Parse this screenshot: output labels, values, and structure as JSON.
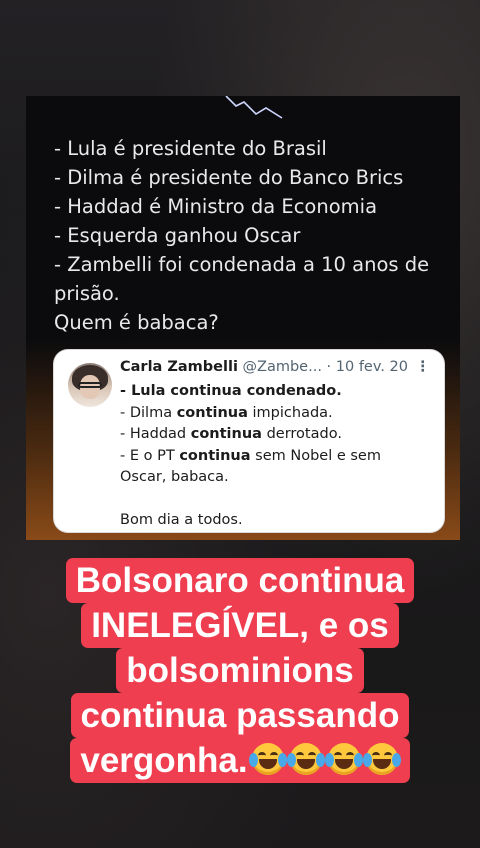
{
  "post": {
    "lines": [
      "- Lula é presidente do Brasil",
      "- Dilma é presidente do Banco Brics",
      "- Haddad é Ministro da Economia",
      "- Esquerda ganhou Oscar",
      "- Zambelli foi condenada a 10 anos de",
      "prisão.",
      "Quem é babaca?"
    ]
  },
  "tweet": {
    "name": "Carla Zambelli",
    "handle": "@Zambe...",
    "date": "· 10 fev. 20",
    "more": "⋮",
    "line1": "- Lula continua condenado.",
    "line2_pre": "- Dilma ",
    "line2_bold": "continua",
    "line2_post": " impichada.",
    "line3_pre": "- Haddad ",
    "line3_bold": "continua",
    "line3_post": " derrotado.",
    "line4_pre": "- E o PT ",
    "line4_bold": "continua",
    "line4_post": " sem Nobel e sem",
    "line5": "Oscar, babaca.",
    "line6": "Bom dia a todos."
  },
  "caption": {
    "line1": "Bolsonaro continua",
    "line2": "INELEGÍVEL, e os",
    "line3": "bolsominions",
    "line4": "continua passando",
    "line5": "vergonha.",
    "emoji_icons": [
      "face-with-tears-of-joy-icon",
      "face-with-tears-of-joy-icon",
      "face-with-tears-of-joy-icon",
      "face-with-tears-of-joy-icon"
    ],
    "highlight_color": "#ee3e4f"
  }
}
